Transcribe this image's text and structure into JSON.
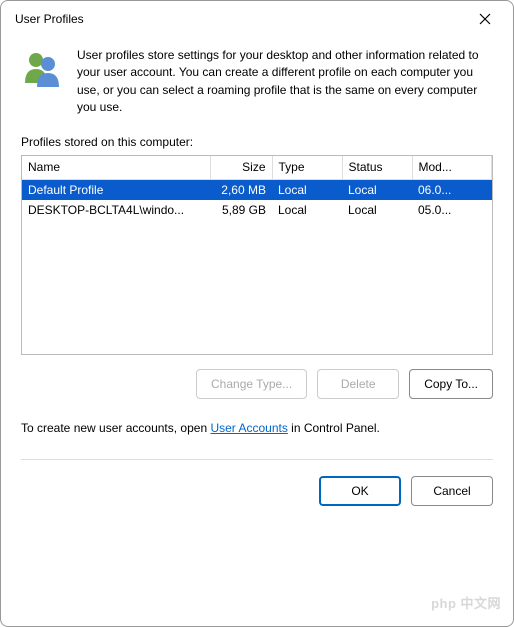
{
  "title": "User Profiles",
  "description": "User profiles store settings for your desktop and other information related to your user account. You can create a different profile on each computer you use, or you can select a roaming profile that is the same on every computer you use.",
  "section_label": "Profiles stored on this computer:",
  "columns": {
    "name": "Name",
    "size": "Size",
    "type": "Type",
    "status": "Status",
    "modified": "Mod..."
  },
  "rows": [
    {
      "name": "Default Profile",
      "size": "2,60 MB",
      "type": "Local",
      "status": "Local",
      "modified": "06.0...",
      "selected": true
    },
    {
      "name": "DESKTOP-BCLTA4L\\windo...",
      "size": "5,89 GB",
      "type": "Local",
      "status": "Local",
      "modified": "05.0...",
      "selected": false
    }
  ],
  "buttons": {
    "change_type": "Change Type...",
    "delete": "Delete",
    "copy_to": "Copy To...",
    "ok": "OK",
    "cancel": "Cancel"
  },
  "hint_prefix": "To create new user accounts, open ",
  "hint_link": "User Accounts",
  "hint_suffix": " in Control Panel.",
  "watermark": "php     中文网"
}
